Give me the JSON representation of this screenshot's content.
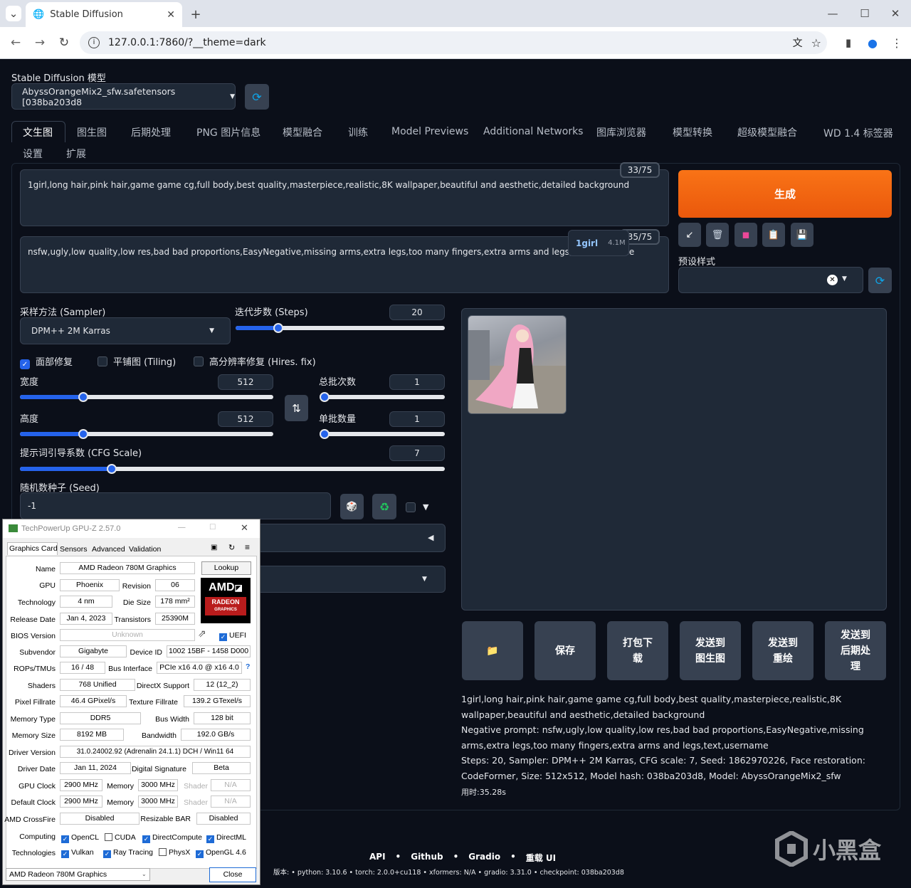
{
  "browser": {
    "tab_title": "Stable Diffusion",
    "url": "127.0.0.1:7860/?__theme=dark"
  },
  "model": {
    "label": "Stable Diffusion 模型",
    "value": "AbyssOrangeMix2_sfw.safetensors [038ba203d8"
  },
  "tabs": [
    "文生图",
    "图生图",
    "后期处理",
    "PNG 图片信息",
    "模型融合",
    "训练",
    "Model Previews",
    "Additional Networks",
    "图库浏览器",
    "模型转换",
    "超级模型融合",
    "WD 1.4 标签器",
    "设置",
    "扩展"
  ],
  "prompt": {
    "text": "1girl,long hair,pink hair,game game cg,full body,best quality,masterpiece,realistic,8K wallpaper,beautiful and aesthetic,detailed background",
    "counter": "33/75"
  },
  "negative": {
    "text": "nsfw,ugly,low quality,low res,bad bad proportions,EasyNegative,missing arms,extra legs,too many fingers,extra arms and legs,text,username",
    "counter": "35/75"
  },
  "autocomplete": {
    "tag": "1girl",
    "count": "4.1M"
  },
  "generate_label": "生成",
  "styles_label": "预设样式",
  "sampler": {
    "label": "采样方法 (Sampler)",
    "value": "DPM++ 2M Karras"
  },
  "steps": {
    "label": "迭代步数 (Steps)",
    "value": "20",
    "fraction": 0.19
  },
  "checks": {
    "face": "面部修复",
    "tiling": "平铺图 (Tiling)",
    "hires": "高分辨率修复 (Hires. fix)"
  },
  "width": {
    "label": "宽度",
    "value": "512",
    "fraction": 0.24
  },
  "height": {
    "label": "高度",
    "value": "512",
    "fraction": 0.24
  },
  "batch_count": {
    "label": "总批次数",
    "value": "1",
    "fraction": 0
  },
  "batch_size": {
    "label": "单批数量",
    "value": "1",
    "fraction": 0
  },
  "cfg": {
    "label": "提示词引导系数 (CFG Scale)",
    "value": "7",
    "fraction": 0.21
  },
  "seed": {
    "label": "随机数种子 (Seed)",
    "value": "-1"
  },
  "output_buttons": [
    "保存",
    "打包下载",
    "发送到图生图",
    "发送到重绘",
    "发送到后期处理"
  ],
  "info": {
    "prompt": "1girl,long hair,pink hair,game game cg,full body,best quality,masterpiece,realistic,8K wallpaper,beautiful and aesthetic,detailed background",
    "negative": "Negative prompt: nsfw,ugly,low quality,low res,bad bad proportions,EasyNegative,missing arms,extra legs,too many fingers,extra arms and legs,text,username",
    "params": "Steps: 20, Sampler: DPM++ 2M Karras, CFG scale: 7, Seed: 1862970226, Face restoration: CodeFormer, Size: 512x512, Model hash: 038ba203d8, Model: AbyssOrangeMix2_sfw",
    "time": "用时:35.28s"
  },
  "footer": {
    "links": [
      "API",
      "Github",
      "Gradio",
      "重载 UI"
    ],
    "versions": "版本: • python: 3.10.6 • torch: 2.0.0+cu118 • xformers: N/A • gradio: 3.31.0 • checkpoint: 038ba203d8"
  },
  "watermark": "小黑盒",
  "gpuz": {
    "title": "TechPowerUp GPU-Z 2.57.0",
    "tabs": [
      "Graphics Card",
      "Sensors",
      "Advanced",
      "Validation"
    ],
    "lookup": "Lookup",
    "uefi": "UEFI",
    "close": "Close",
    "selected": "AMD Radeon 780M Graphics",
    "rows": {
      "name_l": "Name",
      "name_v": "AMD Radeon 780M Graphics",
      "gpu_l": "GPU",
      "gpu_v": "Phoenix",
      "rev_l": "Revision",
      "rev_v": "06",
      "tech_l": "Technology",
      "tech_v": "4 nm",
      "die_l": "Die Size",
      "die_v": "178 mm²",
      "rel_l": "Release Date",
      "rel_v": "Jan 4, 2023",
      "tr_l": "Transistors",
      "tr_v": "25390M",
      "bios_l": "BIOS Version",
      "bios_v": "Unknown",
      "sub_l": "Subvendor",
      "sub_v": "Gigabyte",
      "dev_l": "Device ID",
      "dev_v": "1002 15BF - 1458 D000",
      "rop_l": "ROPs/TMUs",
      "rop_v": "16 / 48",
      "bus_l": "Bus Interface",
      "bus_v": "PCIe x16 4.0 @ x16 4.0",
      "sh_l": "Shaders",
      "sh_v": "768 Unified",
      "dx_l": "DirectX Support",
      "dx_v": "12 (12_2)",
      "pf_l": "Pixel Fillrate",
      "pf_v": "46.4 GPixel/s",
      "tf_l": "Texture Fillrate",
      "tf_v": "139.2 GTexel/s",
      "mt_l": "Memory Type",
      "mt_v": "DDR5",
      "bw_l": "Bus Width",
      "bw_v": "128 bit",
      "ms_l": "Memory Size",
      "ms_v": "8192 MB",
      "band_l": "Bandwidth",
      "band_v": "192.0 GB/s",
      "dv_l": "Driver Version",
      "dv_v": "31.0.24002.92 (Adrenalin 24.1.1) DCH / Win11 64",
      "dd_l": "Driver Date",
      "dd_v": "Jan 11, 2024",
      "ds_l": "Digital Signature",
      "ds_v": "Beta",
      "gc_l": "GPU Clock",
      "gc_v": "2900 MHz",
      "mem_l": "Memory",
      "gc_m": "3000 MHz",
      "shd_l": "Shader",
      "na": "N/A",
      "dc_l": "Default Clock",
      "dc_v": "2900 MHz",
      "dc_m": "3000 MHz",
      "cf_l": "AMD CrossFire",
      "cf_v": "Disabled",
      "rb_l": "Resizable BAR",
      "rb_v": "Disabled",
      "comp_l": "Computing",
      "tech2_l": "Technologies"
    },
    "computing": [
      "OpenCL",
      "CUDA",
      "DirectCompute",
      "DirectML"
    ],
    "technologies": [
      "Vulkan",
      "Ray Tracing",
      "PhysX",
      "OpenGL 4.6"
    ]
  }
}
